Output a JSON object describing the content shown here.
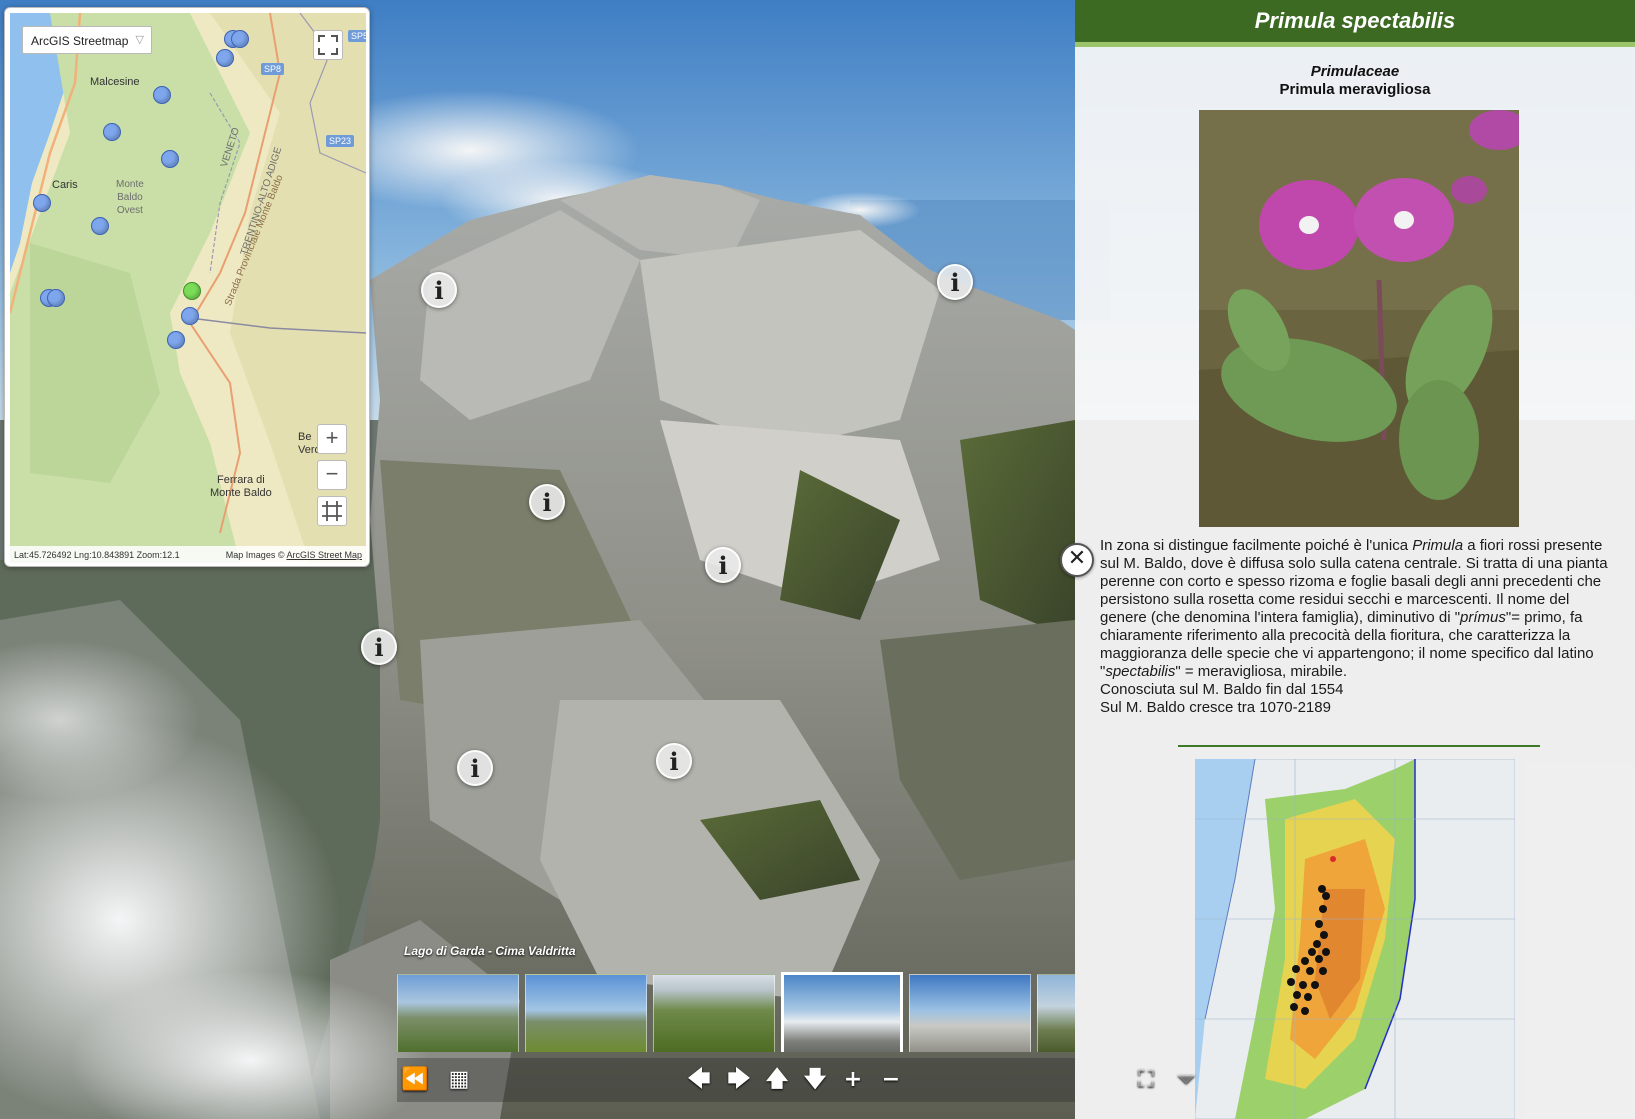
{
  "map": {
    "basemap_select": "ArcGIS Streetmap",
    "places": {
      "malcesine": "Malcesine",
      "caris": "Caris",
      "monte_baldo_ovest": "Monte\nBaldo\nOvest",
      "ferrara": "Ferrara di\nMonte Baldo",
      "be_veronese": "Be\nVeronese",
      "veneto": "VENETO",
      "trentino": "TRENTINO-ALTO ADIGE",
      "sp_road": "SP8",
      "sp23": "SP23",
      "sp_top": "SP5",
      "strada": "Strada Provinciale Monte Baldo"
    },
    "status_left": "Lat:45.726492 Lng:10.843891 Zoom:12.1",
    "status_right_prefix": "Map Images ©",
    "status_right_link": "ArcGIS Street Map",
    "zoom_in": "+",
    "zoom_out": "−",
    "fullscreen_icon": "fullscreen-icon",
    "extent_icon": "crop-icon"
  },
  "info": {
    "title": "Primula spectabilis",
    "family": "Primulaceae",
    "common_name": "Primula meravigliosa",
    "description": {
      "p1_a": "In zona si distingue facilmente poiché è l'unica ",
      "p1_genus": "Primula",
      "p1_b": " a fiori rossi presente sul M. Baldo, dove è diffusa solo sulla catena centrale. Si tratta di una pianta perenne con corto e spesso rizoma e foglie basali degli anni precedenti che persistono sulla rosetta come residui secchi e marcescenti. Il nome del genere (che denomina l'intera famiglia), diminutivo di \"",
      "p1_primus": "prímus",
      "p1_c": "\"= primo, fa chiaramente riferimento alla precocità della fioritura, che caratterizza la maggioranza delle specie che vi appartengono; il nome specifico dal latino \"",
      "p1_spect": "spectabilis",
      "p1_d": "\" = meravigliosa, mirabile.",
      "p2": "Conosciuta sul M. Baldo fin dal 1554",
      "p3": "Sul M. Baldo cresce tra 1070-2189"
    }
  },
  "panorama": {
    "title": "Lago di Garda - Cima Valdritta",
    "hotspot_icon": "info-icon"
  },
  "controls": {
    "rewind": "⏪",
    "grid": "▦",
    "left": "🡄",
    "right": "🡆",
    "up": "🡅",
    "down": "🡇",
    "zoom_in": "+",
    "zoom_out": "−",
    "fullscreen": "⛶",
    "hide": "⏷",
    "close": "✕"
  },
  "colors": {
    "header_green": "#3c6a23",
    "marker_blue": "#7ea6ec",
    "marker_green": "#7bdc58"
  }
}
